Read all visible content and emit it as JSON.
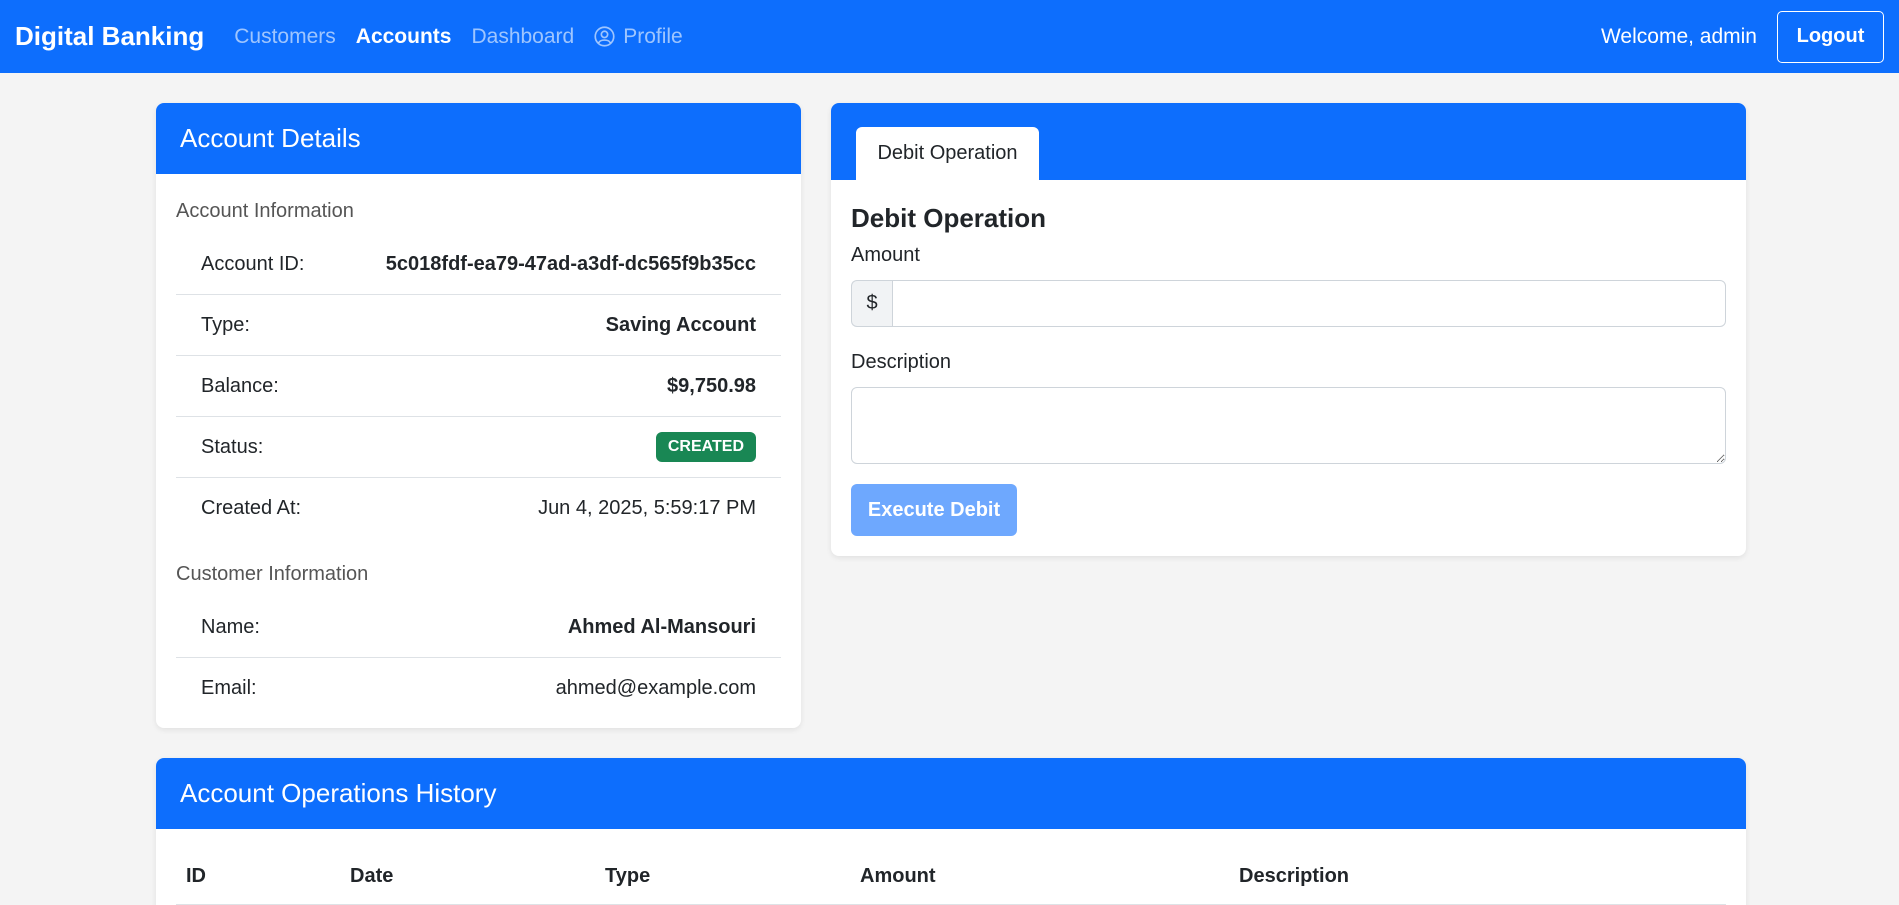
{
  "navbar": {
    "brand": "Digital Banking",
    "links": {
      "customers": "Customers",
      "accounts": "Accounts",
      "dashboard": "Dashboard",
      "profile": "Profile"
    },
    "welcome": "Welcome, admin",
    "logout": "Logout",
    "color": "#0d6efd"
  },
  "account_details": {
    "title": "Account Details",
    "account_section": "Account Information",
    "rows": {
      "id_label": "Account ID:",
      "id_value": "5c018fdf-ea79-47ad-a3df-dc565f9b35cc",
      "type_label": "Type:",
      "type_value": "Saving Account",
      "balance_label": "Balance:",
      "balance_value": "$9,750.98",
      "status_label": "Status:",
      "status_value": "CREATED",
      "created_label": "Created At:",
      "created_value": "Jun 4, 2025, 5:59:17 PM"
    },
    "customer_section": "Customer Information",
    "customer": {
      "name_label": "Name:",
      "name_value": "Ahmed Al-Mansouri",
      "email_label": "Email:",
      "email_value": "ahmed@example.com"
    },
    "status_color": "#198754"
  },
  "debit": {
    "tab": "Debit Operation",
    "title": "Debit Operation",
    "amount_label": "Amount",
    "currency_symbol": "$",
    "amount_value": "",
    "description_label": "Description",
    "description_value": "",
    "execute_button": "Execute Debit"
  },
  "history": {
    "title": "Account Operations History",
    "columns": {
      "id": "ID",
      "date": "Date",
      "type": "Type",
      "amount": "Amount",
      "description": "Description"
    }
  }
}
